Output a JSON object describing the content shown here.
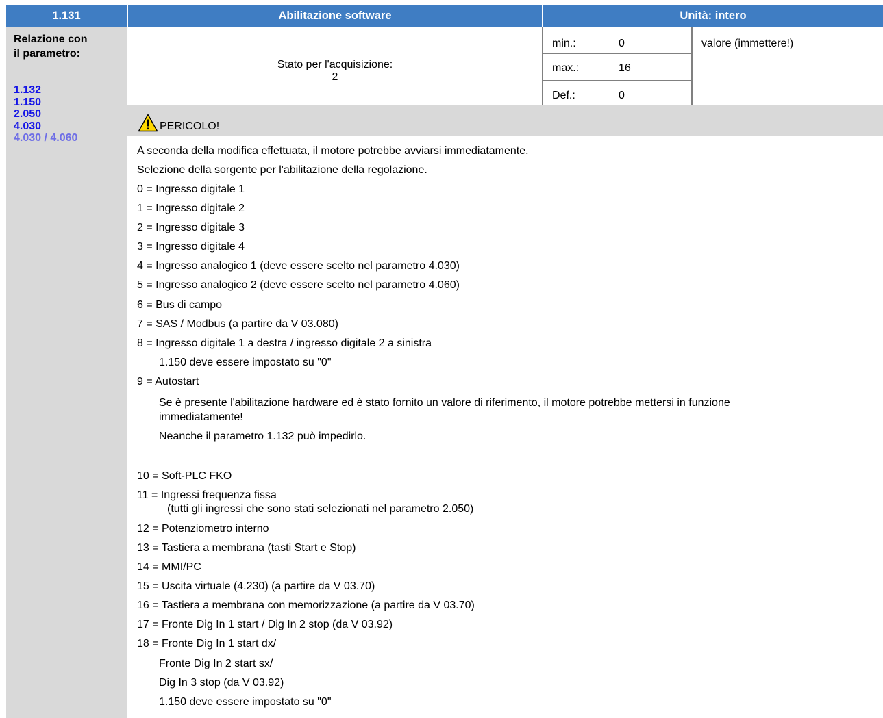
{
  "header": {
    "param_number": "1.131",
    "param_name": "Abilitazione software",
    "unit": "Unità: intero"
  },
  "relation": {
    "label_line1": "Relazione con",
    "label_line2": "il parametro:",
    "links": [
      "1.132",
      "1.150",
      "2.050",
      "4.030"
    ],
    "last_link_a": "4.030",
    "last_link_sep": "/",
    "last_link_b": "4.060"
  },
  "acquisition": {
    "label": "Stato per l'acquisizione:",
    "value": "2"
  },
  "limits": {
    "min_label": "min.:",
    "min_value": "0",
    "max_label": "max.:",
    "max_value": "16",
    "def_label": "Def.:",
    "def_value": "0",
    "value_note": "valore (immettere!)"
  },
  "warning": {
    "icon": "warning-triangle-icon",
    "title": "PERICOLO!"
  },
  "body": {
    "intro1": "A seconda della modifica effettuata, il motore potrebbe avviarsi immediatamente.",
    "intro2": "Selezione della sorgente per l'abilitazione della regolazione.",
    "o0": "0 = Ingresso digitale 1",
    "o1": "1 = Ingresso digitale 2",
    "o2": "2 = Ingresso digitale 3",
    "o3": "3 = Ingresso digitale 4",
    "o4": "4 = Ingresso analogico 1 (deve essere scelto nel parametro 4.030)",
    "o5": "5 = Ingresso analogico 2 (deve essere scelto nel parametro 4.060)",
    "o6": "6 = Bus di campo",
    "o7": "7 = SAS / Modbus (a partire da V 03.080)",
    "o8": "8 = Ingresso digitale 1 a destra / ingresso digitale 2 a sinistra",
    "o8_note": "1.150 deve essere impostato su \"0\"",
    "o9": "9 = Autostart",
    "o9_note1": "Se è presente l'abilitazione hardware ed è stato fornito un valore di riferimento, il motore potrebbe mettersi in funzione",
    "o9_note2": "immediatamente!",
    "o9_note3": "Neanche il parametro 1.132 può impedirlo.",
    "o10": "10 = Soft-PLC FKO",
    "o11": "11 = Ingressi frequenza fissa",
    "o11_note": "(tutti gli ingressi che sono stati selezionati nel parametro 2.050)",
    "o12": "12 = Potenziometro interno",
    "o13": "13 = Tastiera a membrana (tasti Start e Stop)",
    "o14": "14 = MMI/PC",
    "o15": "15 = Uscita virtuale (4.230) (a partire da V 03.70)",
    "o16": "16 = Tastiera a membrana con memorizzazione (a partire da V 03.70)",
    "o17": "17 = Fronte Dig In 1 start / Dig In 2 stop (da V 03.92)",
    "o18": "18 = Fronte Dig In 1 start dx/",
    "o18_l2": "Fronte Dig In 2 start sx/",
    "o18_l3": "Dig In 3 stop (da V 03.92)",
    "o18_l4": "1.150 deve essere impostato su \"0\""
  },
  "colors": {
    "header_bg": "#3F7DC3",
    "side_bg": "#D9D9D9",
    "link": "#1414E6",
    "link_light": "#6E6EE6",
    "warning": "#FFD800"
  }
}
